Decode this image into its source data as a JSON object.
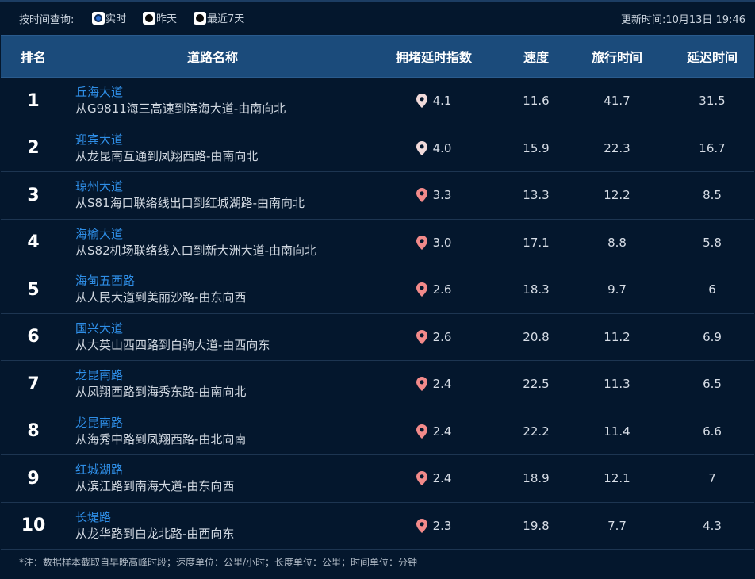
{
  "filter": {
    "label": "按时间查询:",
    "options": [
      {
        "label": "实时",
        "selected": true
      },
      {
        "label": "昨天",
        "selected": false
      },
      {
        "label": "最近7天",
        "selected": false
      }
    ]
  },
  "update_time": "更新时间:10月13日 19:46",
  "table": {
    "headers": {
      "rank": "排名",
      "road": "道路名称",
      "index": "拥堵延时指数",
      "speed": "速度",
      "travel": "旅行时间",
      "delay": "延迟时间"
    },
    "rows": [
      {
        "rank": "1",
        "name": "丘海大道",
        "desc": "从G9811海三高速到滨海大道-由南向北",
        "index": "4.1",
        "speed": "11.6",
        "travel": "41.7",
        "delay": "31.5",
        "pin_color": "#f1dada"
      },
      {
        "rank": "2",
        "name": "迎宾大道",
        "desc": "从龙昆南互通到凤翔西路-由南向北",
        "index": "4.0",
        "speed": "15.9",
        "travel": "22.3",
        "delay": "16.7",
        "pin_color": "#f1dada"
      },
      {
        "rank": "3",
        "name": "琼州大道",
        "desc": "从S81海口联络线出口到红城湖路-由南向北",
        "index": "3.3",
        "speed": "13.3",
        "travel": "12.2",
        "delay": "8.5",
        "pin_color": "#f28a8a"
      },
      {
        "rank": "4",
        "name": "海榆大道",
        "desc": "从S82机场联络线入口到新大洲大道-由南向北",
        "index": "3.0",
        "speed": "17.1",
        "travel": "8.8",
        "delay": "5.8",
        "pin_color": "#f28a8a"
      },
      {
        "rank": "5",
        "name": "海甸五西路",
        "desc": "从人民大道到美丽沙路-由东向西",
        "index": "2.6",
        "speed": "18.3",
        "travel": "9.7",
        "delay": "6",
        "pin_color": "#f28a8a"
      },
      {
        "rank": "6",
        "name": "国兴大道",
        "desc": "从大英山西四路到白驹大道-由西向东",
        "index": "2.6",
        "speed": "20.8",
        "travel": "11.2",
        "delay": "6.9",
        "pin_color": "#f28a8a"
      },
      {
        "rank": "7",
        "name": "龙昆南路",
        "desc": "从凤翔西路到海秀东路-由南向北",
        "index": "2.4",
        "speed": "22.5",
        "travel": "11.3",
        "delay": "6.5",
        "pin_color": "#f28a8a"
      },
      {
        "rank": "8",
        "name": "龙昆南路",
        "desc": "从海秀中路到凤翔西路-由北向南",
        "index": "2.4",
        "speed": "22.2",
        "travel": "11.4",
        "delay": "6.6",
        "pin_color": "#f28a8a"
      },
      {
        "rank": "9",
        "name": "红城湖路",
        "desc": "从滨江路到南海大道-由东向西",
        "index": "2.4",
        "speed": "18.9",
        "travel": "12.1",
        "delay": "7",
        "pin_color": "#f28a8a"
      },
      {
        "rank": "10",
        "name": "长堤路",
        "desc": "从龙华路到白龙北路-由西向东",
        "index": "2.3",
        "speed": "19.8",
        "travel": "7.7",
        "delay": "4.3",
        "pin_color": "#f28a8a"
      }
    ]
  },
  "footnote": "*注：数据样本截取自早晚高峰时段；速度单位：公里/小时；长度单位：公里；时间单位：分钟",
  "colors": {
    "background": "#04172d",
    "header": "#1b4b7b",
    "road_link": "#2f8fe8"
  }
}
